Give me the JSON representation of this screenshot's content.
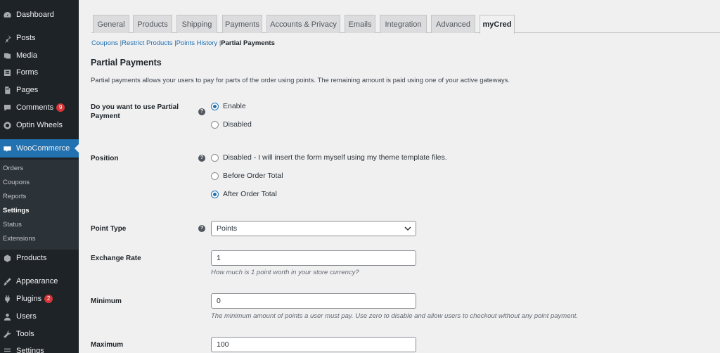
{
  "sidebar": {
    "items": [
      {
        "label": "Dashboard",
        "icon": "dashboard-icon"
      },
      {
        "label": "Posts",
        "icon": "pin-icon"
      },
      {
        "label": "Media",
        "icon": "media-icon"
      },
      {
        "label": "Forms",
        "icon": "forms-icon"
      },
      {
        "label": "Pages",
        "icon": "pages-icon"
      },
      {
        "label": "Comments",
        "icon": "comment-icon",
        "badge": "9"
      },
      {
        "label": "Optin Wheels",
        "icon": "wheel-icon"
      },
      {
        "label": "WooCommerce",
        "icon": "woocommerce-icon"
      },
      {
        "label": "Products",
        "icon": "box-icon"
      },
      {
        "label": "Appearance",
        "icon": "brush-icon"
      },
      {
        "label": "Plugins",
        "icon": "plug-icon",
        "badge": "2"
      },
      {
        "label": "Users",
        "icon": "users-icon"
      },
      {
        "label": "Tools",
        "icon": "wrench-icon"
      },
      {
        "label": "Settings",
        "icon": "settings-icon"
      }
    ],
    "submenu": [
      "Orders",
      "Coupons",
      "Reports",
      "Settings",
      "Status",
      "Extensions"
    ],
    "submenu_current": "Settings"
  },
  "tabs": [
    "General",
    "Products",
    "Shipping",
    "Payments",
    "Accounts & Privacy",
    "Emails",
    "Integration",
    "Advanced",
    "myCred"
  ],
  "active_tab": "myCred",
  "subsubsub": {
    "links": [
      "Coupons",
      "Restrict Products",
      "Points History"
    ],
    "current": "Partial Payments",
    "separator": "|"
  },
  "section": {
    "title": "Partial Payments",
    "description": "Partial payments allows your users to pay for parts of the order using points. The remaining amount is paid using one of your active gateways."
  },
  "fields": {
    "use_partial": {
      "label_line1": "Do you want to use Partial",
      "label_line2": "Payment",
      "options": [
        "Enable",
        "Disabled"
      ],
      "selected": "Enable"
    },
    "position": {
      "label": "Position",
      "options": [
        "Disabled - I will insert the form myself using my theme template files.",
        "Before Order Total",
        "After Order Total"
      ],
      "selected": "After Order Total"
    },
    "point_type": {
      "label": "Point Type",
      "value": "Points"
    },
    "exchange_rate": {
      "label": "Exchange Rate",
      "value": "1",
      "description": "How much is 1 point worth in your store currency?"
    },
    "minimum": {
      "label": "Minimum",
      "value": "0",
      "description": "The minimum amount of points a user must pay. Use zero to disable and allow users to checkout without any point payment."
    },
    "maximum": {
      "label": "Maximum",
      "value": "100"
    }
  },
  "help_glyph": "?",
  "colors": {
    "sidebar_bg": "#1d2327",
    "accent": "#2271b1",
    "badge": "#d63638",
    "page_bg": "#f0f0f1"
  }
}
